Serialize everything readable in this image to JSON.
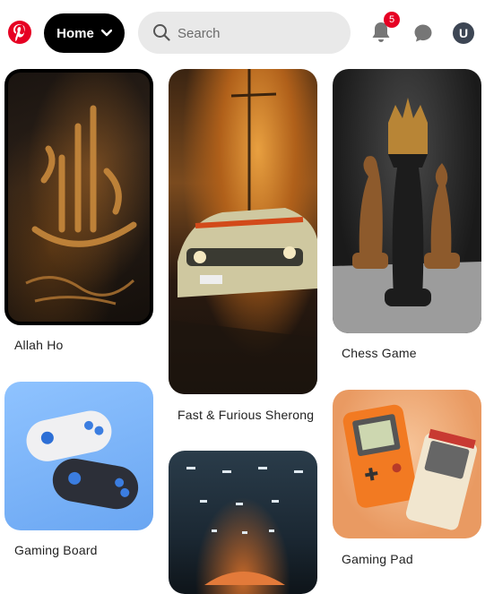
{
  "header": {
    "home_label": "Home",
    "search_placeholder": "Search",
    "notification_count": "5",
    "avatar_initial": "U"
  },
  "pins": [
    {
      "title": "Allah Ho",
      "image": "arabic-calligraphy-art"
    },
    {
      "title": "Fast & Furious Sherong",
      "image": "muscle-car-street-art"
    },
    {
      "title": "Chess Game",
      "image": "chess-king-pieces"
    },
    {
      "title": "Gaming Board",
      "image": "game-controllers-3d"
    },
    {
      "title": "",
      "image": "car-garage-lights"
    },
    {
      "title": "Gaming Pad",
      "image": "handheld-consoles"
    }
  ],
  "colors": {
    "brand": "#e60023",
    "home_button_bg": "#000000",
    "search_bg": "#e9e9e9",
    "avatar_bg": "#3d4654"
  }
}
